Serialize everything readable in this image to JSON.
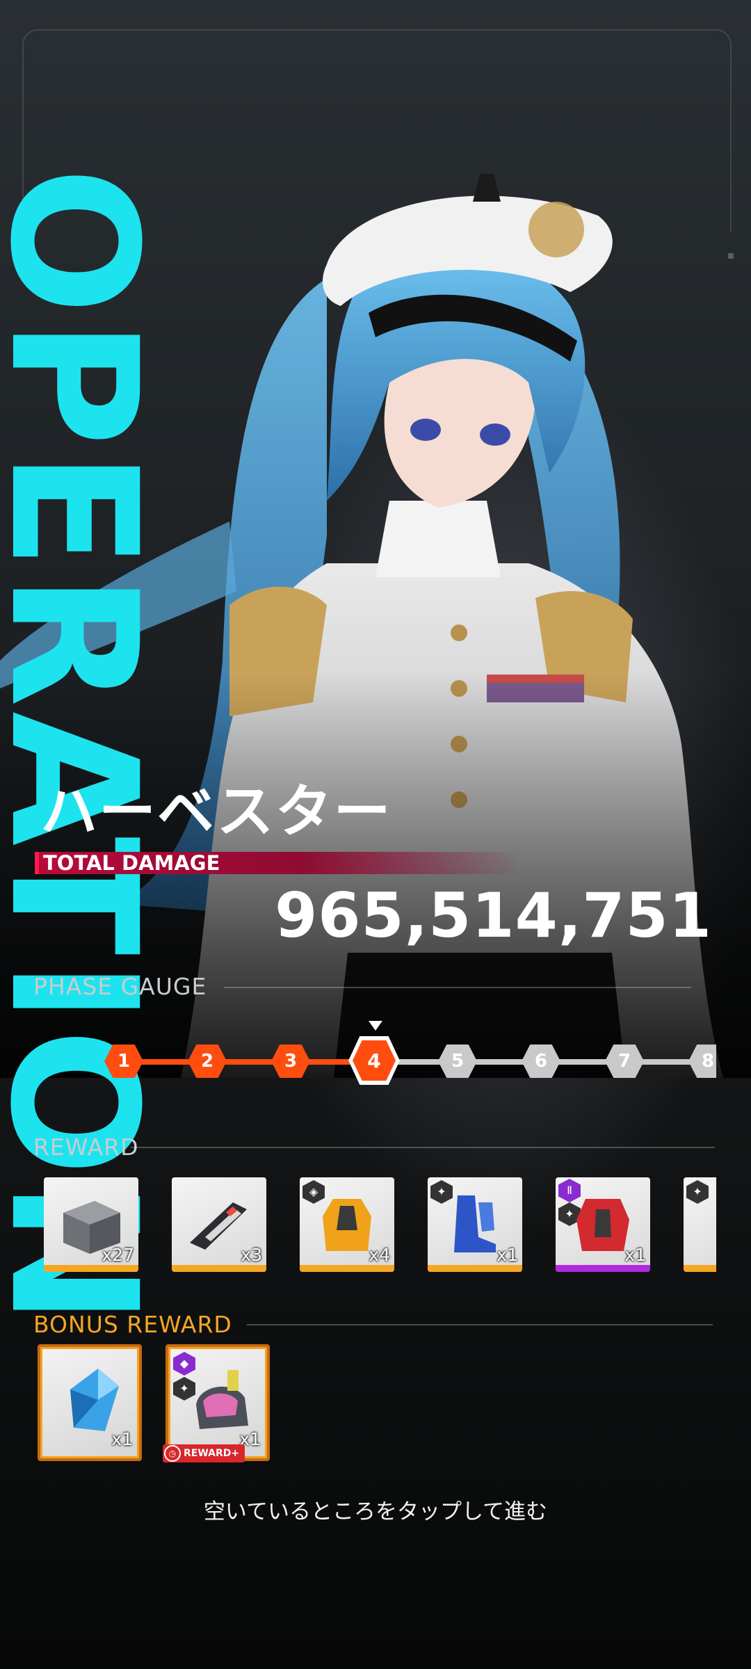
{
  "banner": {
    "vertical_title": "OPERATION"
  },
  "character": {
    "name": "ハーベスター"
  },
  "damage": {
    "label": "TOTAL DAMAGE",
    "value": "965,514,751"
  },
  "phase_gauge": {
    "title": "PHASE GAUGE",
    "current_phase": 4,
    "phases": [
      "1",
      "2",
      "3",
      "4",
      "5",
      "6",
      "7",
      "8"
    ]
  },
  "reward": {
    "title": "REWARD",
    "items": [
      {
        "name": "supply-crate",
        "qty": "x27",
        "rarity_color": "#f5a623"
      },
      {
        "name": "weapon-part",
        "qty": "x3",
        "rarity_color": "#f5a623"
      },
      {
        "name": "yellow-armor",
        "qty": "x4",
        "rarity_color": "#f5a623"
      },
      {
        "name": "blue-boots",
        "qty": "x1",
        "rarity_color": "#f5a623"
      },
      {
        "name": "red-armor",
        "qty": "x1",
        "rarity_color": "#b02bdc"
      },
      {
        "name": "partial-item",
        "qty": "",
        "rarity_color": "#f5a623"
      }
    ]
  },
  "bonus_reward": {
    "title": "BONUS REWARD",
    "items": [
      {
        "name": "blue-crystal",
        "qty": "x1"
      },
      {
        "name": "pink-gear",
        "qty": "x1",
        "tag": "REWARD+"
      }
    ]
  },
  "footer": {
    "hint": "空いているところをタップして進む"
  },
  "colors": {
    "accent_cyan": "#1de3ef",
    "phase_done": "#ff4d0f",
    "phase_todo": "#c9c9c9",
    "damage_bar": "#b80a3a",
    "bonus_title": "#f5a623"
  }
}
